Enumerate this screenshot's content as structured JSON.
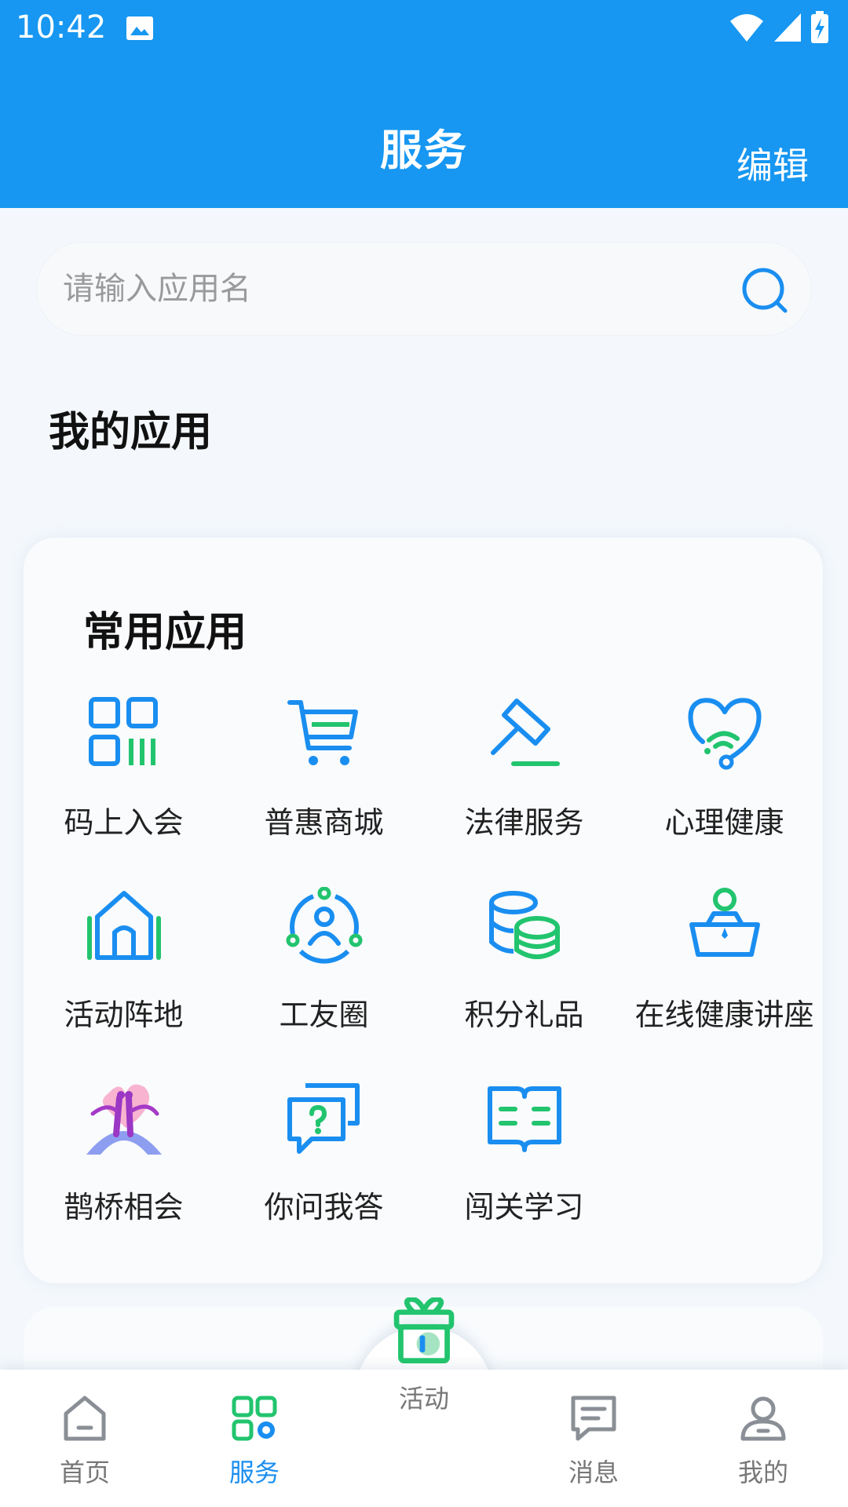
{
  "status": {
    "time": "10:42"
  },
  "header": {
    "title": "服务",
    "edit_label": "编辑"
  },
  "search": {
    "placeholder": "请输入应用名"
  },
  "my_apps": {
    "title": "我的应用"
  },
  "common_apps": {
    "title": "常用应用",
    "items": [
      {
        "label": "码上入会",
        "icon": "qr-code-icon"
      },
      {
        "label": "普惠商城",
        "icon": "shopping-cart-icon"
      },
      {
        "label": "法律服务",
        "icon": "gavel-icon"
      },
      {
        "label": "心理健康",
        "icon": "heart-stethoscope-icon"
      },
      {
        "label": "活动阵地",
        "icon": "house-icon"
      },
      {
        "label": "工友圈",
        "icon": "people-circle-icon"
      },
      {
        "label": "积分礼品",
        "icon": "coins-stack-icon"
      },
      {
        "label": "在线健康讲座",
        "icon": "lecture-icon"
      },
      {
        "label": "鹊桥相会",
        "icon": "bridge-couple-icon"
      },
      {
        "label": "你问我答",
        "icon": "qa-chat-icon"
      },
      {
        "label": "闯关学习",
        "icon": "open-book-icon"
      }
    ]
  },
  "tabbar": {
    "items": [
      {
        "label": "首页",
        "icon": "home-icon",
        "active": false
      },
      {
        "label": "服务",
        "icon": "services-grid-icon",
        "active": true
      },
      {
        "label": "活动",
        "icon": "gift-icon",
        "active": false
      },
      {
        "label": "消息",
        "icon": "message-icon",
        "active": false
      },
      {
        "label": "我的",
        "icon": "user-icon",
        "active": false
      }
    ]
  },
  "colors": {
    "brand_blue": "#1797f1",
    "icon_blue": "#1a8ef0",
    "icon_green": "#22c46e"
  }
}
